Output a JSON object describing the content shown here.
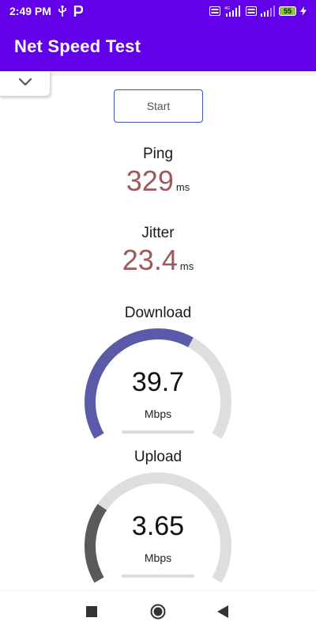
{
  "status_bar": {
    "time": "2:49 PM",
    "left_icons": [
      "usb-icon",
      "parking-icon"
    ],
    "right_icons": [
      "volte-icon",
      "signal-4g-icon",
      "volte-icon",
      "signal-icon"
    ],
    "network_label": "4G",
    "volte_label": "Vo LTE",
    "battery_level": "55"
  },
  "app_bar": {
    "title": "Net Speed Test",
    "background": "#6200ea"
  },
  "controls": {
    "collapse_icon": "chevron-down-icon",
    "start_label": "Start",
    "accent": "#3f51b5"
  },
  "metrics": {
    "ping": {
      "label": "Ping",
      "value": "329",
      "unit": "ms"
    },
    "jitter": {
      "label": "Jitter",
      "value": "23.4",
      "unit": "ms"
    },
    "value_color": "#a0595a"
  },
  "gauges": {
    "download": {
      "label": "Download",
      "value": "39.7",
      "unit": "Mbps",
      "fraction": 0.62,
      "color": "#5b5aa8"
    },
    "upload": {
      "label": "Upload",
      "value": "3.65",
      "unit": "Mbps",
      "fraction": 0.27,
      "color": "#5a5a5a"
    },
    "track_color": "#dedede"
  },
  "nav_bar": {
    "icons": [
      "recents-square-icon",
      "home-circle-icon",
      "back-triangle-icon"
    ]
  }
}
